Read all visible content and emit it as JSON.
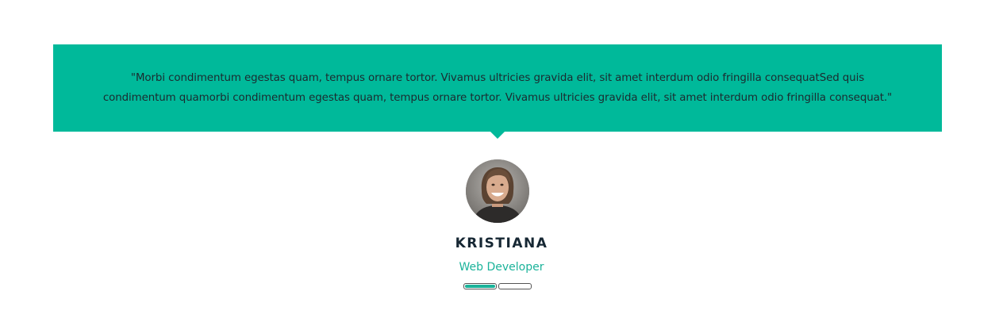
{
  "testimonial": {
    "quote": "\"Morbi condimentum egestas quam, tempus ornare tortor. Vivamus ultricies gravida elit, sit amet interdum odio fringilla consequatSed quis condimentum quamorbi condimentum egestas quam, tempus ornare tortor. Vivamus ultricies gravida elit, sit amet interdum odio fringilla consequat.\"",
    "name": "KRISTIANA",
    "role": "Web Developer",
    "avatar_icon": "person-photo"
  },
  "pager": {
    "slides": 2,
    "active": 1
  },
  "colors": {
    "accent": "#00b99a",
    "name_text": "#162733",
    "role_text": "#1bb39a",
    "quote_text": "#1b2a2f"
  }
}
